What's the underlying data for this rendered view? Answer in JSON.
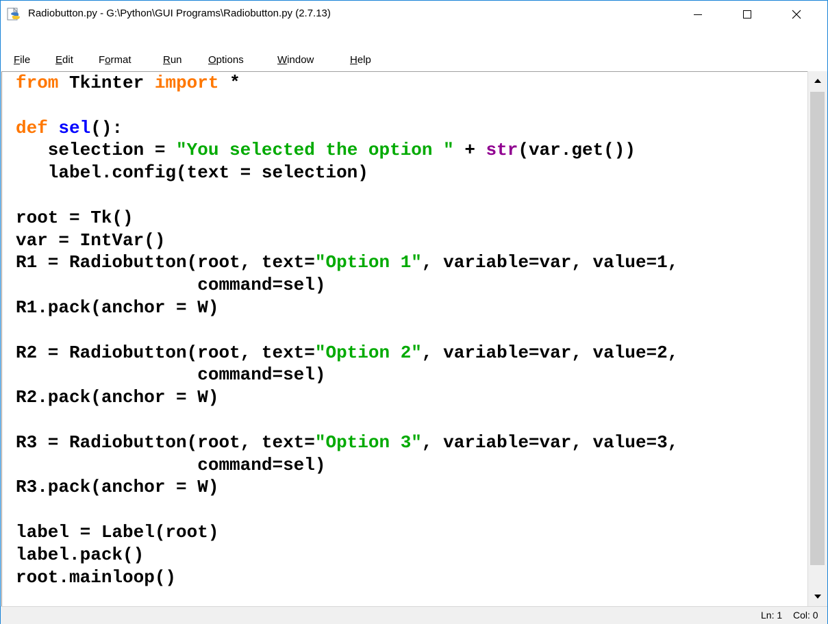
{
  "window": {
    "title": "Radiobutton.py - G:\\Python\\GUI Programs\\Radiobutton.py (2.7.13)",
    "icon": "idle-python-file-icon"
  },
  "controls": {
    "minimize": "minimize-icon",
    "maximize": "maximize-icon",
    "close": "close-icon"
  },
  "menu": {
    "file": {
      "first": "F",
      "rest": "ile"
    },
    "edit": {
      "first": "E",
      "rest": "dit"
    },
    "format": {
      "pre": "F",
      "first": "o",
      "rest": "rmat"
    },
    "run": {
      "first": "R",
      "rest": "un"
    },
    "options": {
      "first": "O",
      "rest": "ptions"
    },
    "window": {
      "first": "W",
      "rest": "indow"
    },
    "help": {
      "first": "H",
      "rest": "elp"
    }
  },
  "colors": {
    "keyword": "#ff7700",
    "definition": "#0000ff",
    "string": "#00aa00",
    "builtin": "#900090",
    "window_border": "#1883d7"
  },
  "code": {
    "l1": {
      "kw1": "from",
      "t1": " Tkinter ",
      "kw2": "import",
      "t2": " *"
    },
    "l3": {
      "kw": "def",
      "sp": " ",
      "name": "sel",
      "rest": "():"
    },
    "l4": {
      "pre": "   selection = ",
      "str": "\"You selected the option \"",
      "mid": " + ",
      "bi": "str",
      "post": "(var.get())"
    },
    "l5": "   label.config(text = selection)",
    "l7": "root = Tk()",
    "l8": "var = IntVar()",
    "l9": {
      "pre": "R1 = Radiobutton(root, text=",
      "str": "\"Option 1\"",
      "post": ", variable=var, value=1,"
    },
    "l10": "                 command=sel)",
    "l11": "R1.pack(anchor = W)",
    "l13": {
      "pre": "R2 = Radiobutton(root, text=",
      "str": "\"Option 2\"",
      "post": ", variable=var, value=2,"
    },
    "l14": "                 command=sel)",
    "l15": "R2.pack(anchor = W)",
    "l17": {
      "pre": "R3 = Radiobutton(root, text=",
      "str": "\"Option 3\"",
      "post": ", variable=var, value=3,"
    },
    "l18": "                 command=sel)",
    "l19": "R3.pack(anchor = W)",
    "l21": "label = Label(root)",
    "l22": "label.pack()",
    "l23": "root.mainloop()"
  },
  "status": {
    "line": "Ln: 1",
    "col": "Col: 0"
  }
}
